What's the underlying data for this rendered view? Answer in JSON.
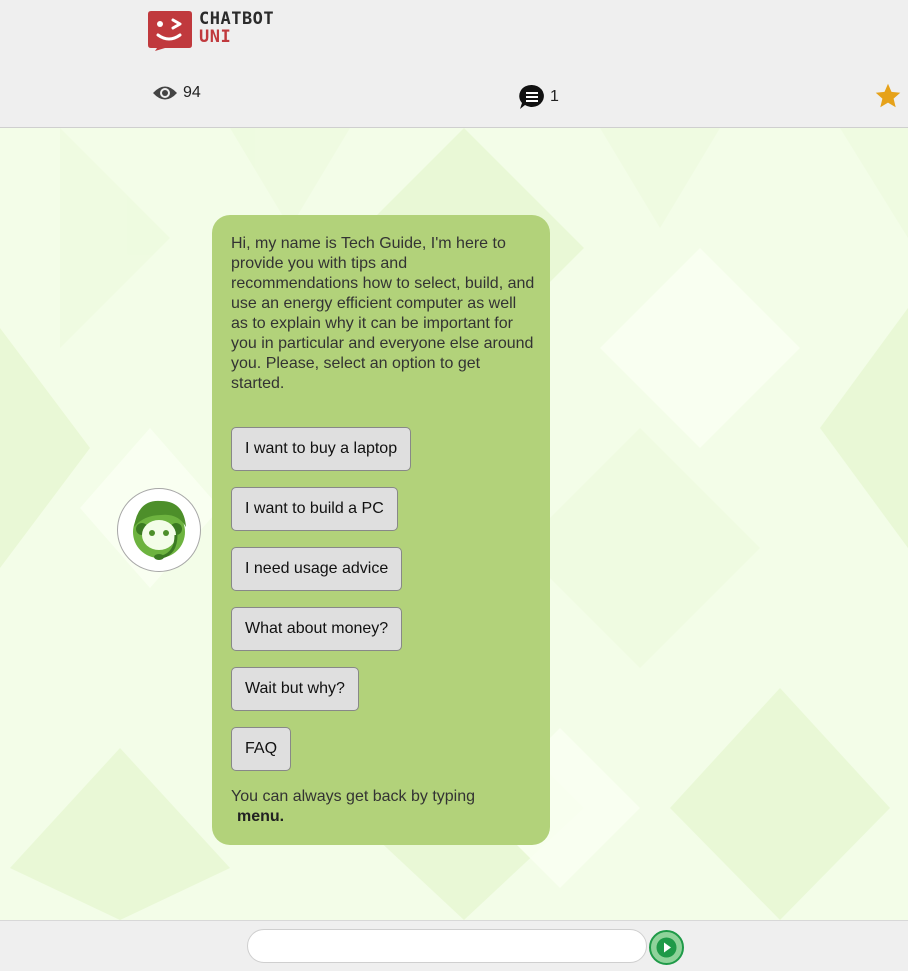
{
  "header": {
    "logo": {
      "line1": "CHATBOT",
      "line2": "UNI",
      "icon": "winking-face-icon"
    },
    "views": {
      "icon": "eye-icon",
      "count": "94"
    },
    "comments": {
      "icon": "comment-icon",
      "count": "1"
    },
    "favorite": {
      "icon": "star-icon"
    }
  },
  "chat": {
    "avatar": {
      "icon": "support-agent-icon"
    },
    "message": "Hi, my name is Tech Guide, I'm here to provide you with tips and recommendations how to select, build, and use an energy efficient computer as well as to explain why it can be important for you in particular and everyone else around you. Please, select an option to get started.",
    "options": [
      "I want to buy a laptop",
      "I want to build a PC",
      "I need usage advice",
      "What about money?",
      "Wait but why?",
      "FAQ"
    ],
    "back_hint": "You can always get back by typing",
    "back_keyword": "menu."
  },
  "input": {
    "value": "",
    "placeholder": ""
  },
  "send": {
    "icon": "play-icon"
  },
  "colors": {
    "bubble": "#b2d27a",
    "brand_red": "#c0393d",
    "star": "#e6a21a",
    "send_green": "#1f9a48"
  }
}
